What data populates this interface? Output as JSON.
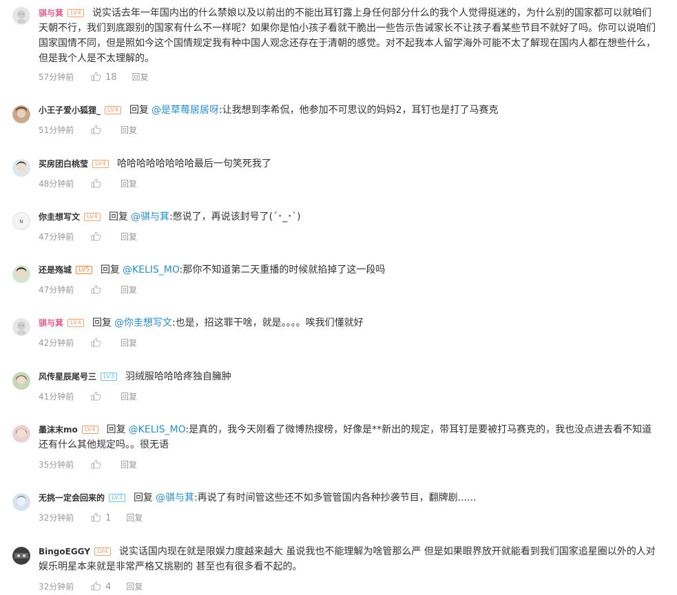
{
  "reply_word": "回复",
  "like_icon": "thumbs-up-icon",
  "comments": [
    {
      "user": "骐与萁",
      "level": "LV4",
      "user_color": "pink",
      "mention": "",
      "text": "说实话去年一年国内出的什么禁娘以及以前出的不能出耳钉露上身任何部分什么的我个人觉得挺迷的，为什么别的国家都可以就咱们天朝不行，我们到底跟别的国家有什么不一样呢？如果你是怕小孩子看就干脆出一些告示告诫家长不让孩子看某些节目不就好了吗。你可以说咱们国家国情不同，但是照如今这个国情规定我有种中国人观念还存在于清朝的感觉。对不起我本人留学海外可能不太了解现在国内人都在想些什么，但是我个人是不太理解的。",
      "time": "57分钟前",
      "likes": "18",
      "reply": "回复"
    },
    {
      "user": "小王子爱小狐狸_",
      "level": "LV4",
      "user_color": "dark",
      "mention": "@是草莓居居呀",
      "text": ":让我想到李希侃，他参加不可思议的妈妈2，耳钉也是打了马赛克",
      "time": "51分钟前",
      "likes": "",
      "reply": "回复"
    },
    {
      "user": "买房团白桃莹",
      "level": "LV4",
      "user_color": "dark",
      "mention": "",
      "text": "哈哈哈哈哈哈哈哈最后一句笑死我了",
      "time": "48分钟前",
      "likes": "",
      "reply": "回复"
    },
    {
      "user": "你圭想写文",
      "level": "LV4",
      "user_color": "dark",
      "mention": "@骐与萁",
      "text": ":憋说了，再说该封号了(´･_･`)",
      "time": "47分钟前",
      "likes": "",
      "reply": "回复"
    },
    {
      "user": "还是殇城",
      "level": "LV5",
      "user_color": "dark",
      "mention": "@KELIS_MO",
      "text": ":那你不知道第二天重播的时候就掐掉了这一段吗",
      "time": "47分钟前",
      "likes": "",
      "reply": "回复"
    },
    {
      "user": "骐与萁",
      "level": "LV4",
      "user_color": "pink",
      "mention": "@你圭想写文",
      "text": ":也是，招这罪干啥，就是。。。。唉我们懂就好",
      "time": "42分钟前",
      "likes": "",
      "reply": "回复"
    },
    {
      "user": "风传星辰尾号三",
      "level": "LV3",
      "user_color": "dark",
      "mention": "",
      "text": "羽绒服哈哈哈疼独自臃肿",
      "time": "41分钟前",
      "likes": "",
      "reply": "回复"
    },
    {
      "user": "墨沫末mo",
      "level": "LV4",
      "user_color": "dark",
      "mention": "@KELIS_MO",
      "text": ":是真的，我今天刚看了微博热搜榜，好像是**新出的规定，带耳钉是要被打马赛克的，我也没点进去看不知道还有什么其他规定吗。。很无语",
      "time": "35分钟前",
      "likes": "",
      "reply": "回复"
    },
    {
      "user": "无挑一定会回来的",
      "level": "LV3",
      "user_color": "dark",
      "mention": "@骐与萁",
      "text": ":再说了有时间管这些还不如多管管国内各种抄袭节目，翻牌剧......",
      "time": "32分钟前",
      "likes": "1",
      "reply": "回复"
    },
    {
      "user": "BingoEGGY",
      "level": "LV4",
      "user_color": "dark",
      "mention": "",
      "text": "说实话国内现在就是限娱力度越来越大 虽说我也不能理解为啥管那么严 但是如果眼界放开就能看到我们国家追星圈以外的人对娱乐明星本来就是非常严格又挑剔的 甚至也有很多看不起的。",
      "time": "32分钟前",
      "likes": "4",
      "reply": "回复"
    }
  ]
}
